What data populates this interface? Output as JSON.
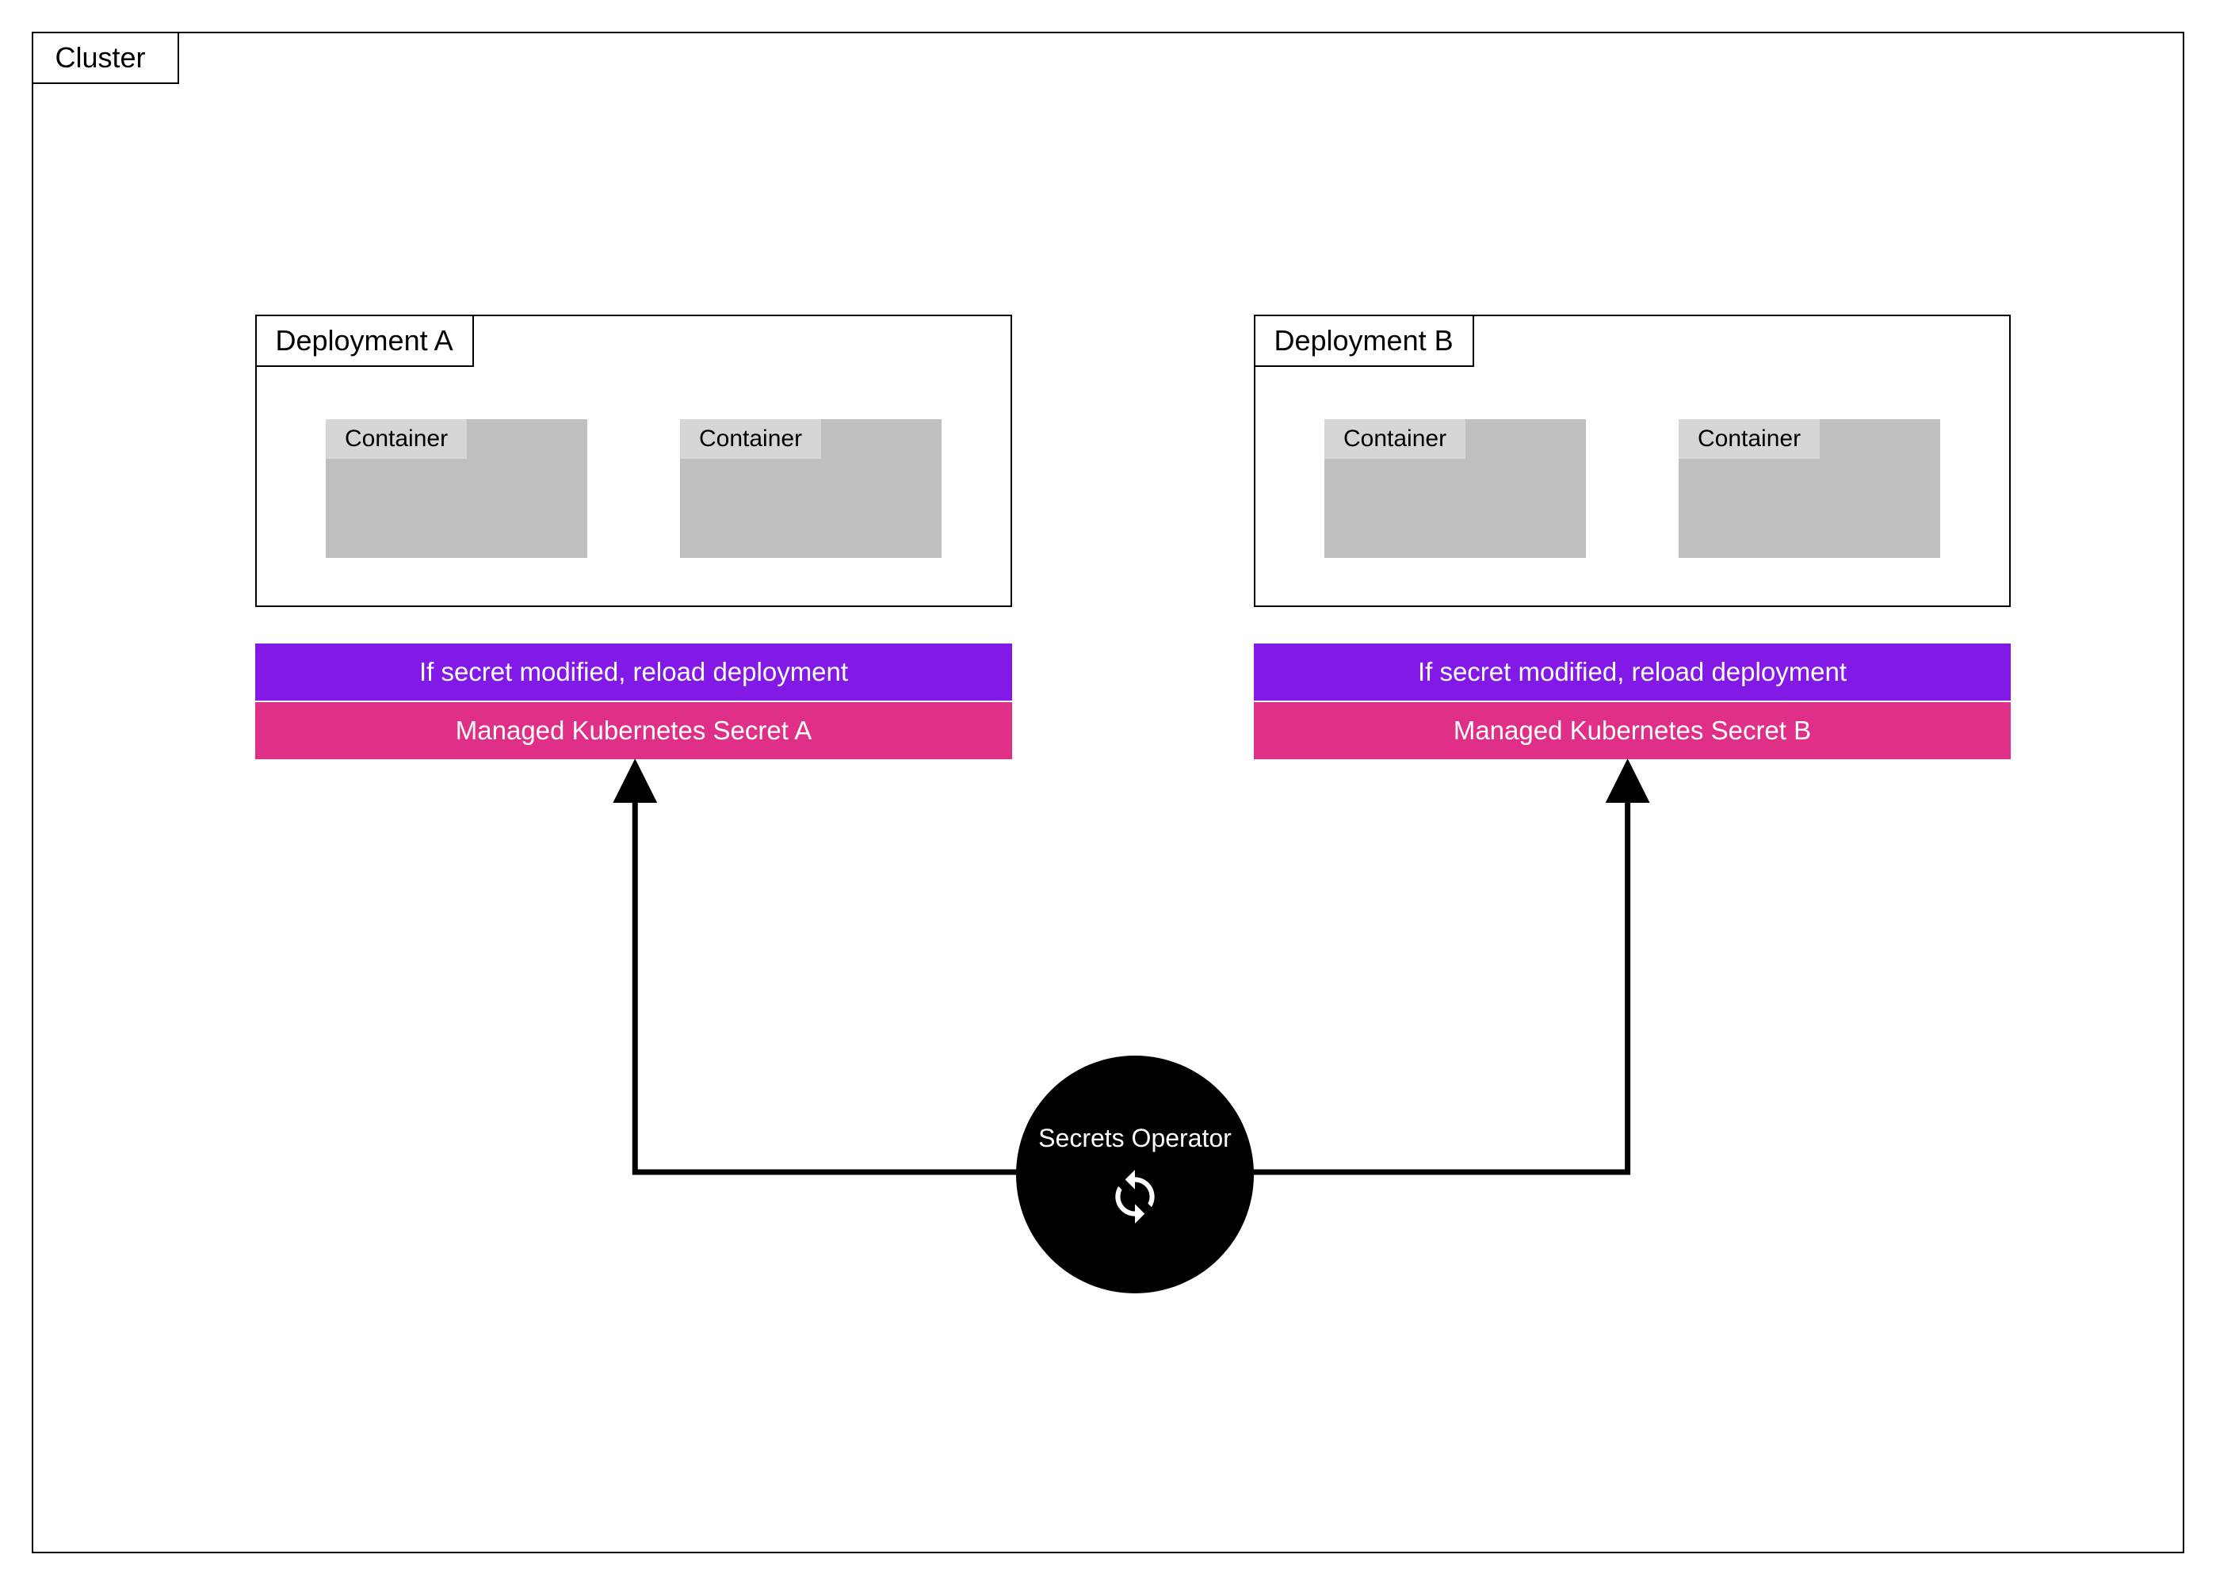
{
  "cluster": {
    "label": "Cluster"
  },
  "deployments": {
    "a": {
      "label": "Deployment A",
      "containers": [
        "Container",
        "Container"
      ],
      "reloadText": "If secret modified, reload deployment",
      "secretText": "Managed Kubernetes Secret A"
    },
    "b": {
      "label": "Deployment B",
      "containers": [
        "Container",
        "Container"
      ],
      "reloadText": "If secret modified, reload deployment",
      "secretText": "Managed Kubernetes Secret B"
    }
  },
  "operator": {
    "label": "Secrets Operator"
  },
  "colors": {
    "reloadBar": "#8319e8",
    "secretBar": "#df2f86",
    "containerFill": "#bfbfbf",
    "containerTag": "#d6d6d6",
    "operatorFill": "#000000"
  }
}
